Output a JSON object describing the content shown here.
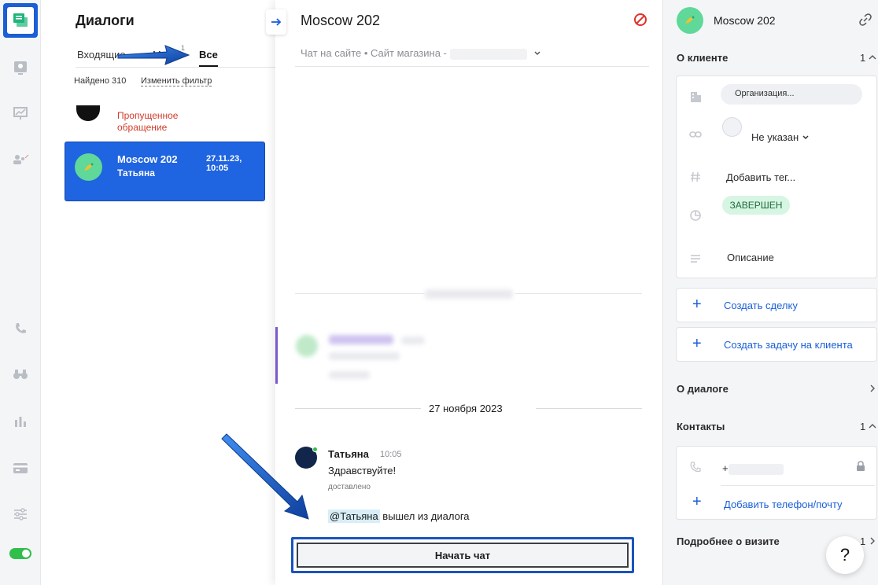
{
  "list": {
    "title": "Диалоги",
    "tabs": [
      {
        "label": "Входящие"
      },
      {
        "label": "М"
      },
      {
        "label": "Все"
      }
    ],
    "tab_count": "1",
    "found": "Найдено 310",
    "change_filter": "Изменить фильтр",
    "missed_line1": "Пропущенное",
    "missed_line2": "обращение",
    "active_item": {
      "name": "Moscow 202",
      "sub": "Татьяна",
      "date": "27.11.23, 10:05"
    }
  },
  "chat": {
    "title": "Moscow 202",
    "subtitle": "Чат на сайте • Сайт магазина -",
    "date_separator": "27 ноября 2023",
    "message": {
      "author": "Татьяна",
      "time": "10:05",
      "text": "Здравствуйте!",
      "status": "доставлено"
    },
    "system_mention": "@Татьяна",
    "system_text": " вышел из диалога",
    "start_button": "Начать чат"
  },
  "info": {
    "title": "Moscow 202",
    "about_client": "О клиенте",
    "about_client_count": "1",
    "organization_placeholder": "Организация...",
    "responsible": "Не указан",
    "add_tag": "Добавить тег...",
    "status_badge": "ЗАВЕРШЕН",
    "description": "Описание",
    "create_deal": "Создать сделку",
    "create_task": "Создать задачу на клиента",
    "about_dialog": "О диалоге",
    "contacts": "Контакты",
    "contacts_count": "1",
    "phone_prefix": "+",
    "add_phone": "Добавить телефон/почту",
    "visit_details": "Подробнее о визите",
    "visit_count": "1",
    "help": "?"
  },
  "colors": {
    "accent": "#1a5fd6",
    "active_item": "#1f64e0",
    "status_done_bg": "#d7f5e3",
    "missed": "#d23b2b",
    "online": "#2fbf4a"
  }
}
